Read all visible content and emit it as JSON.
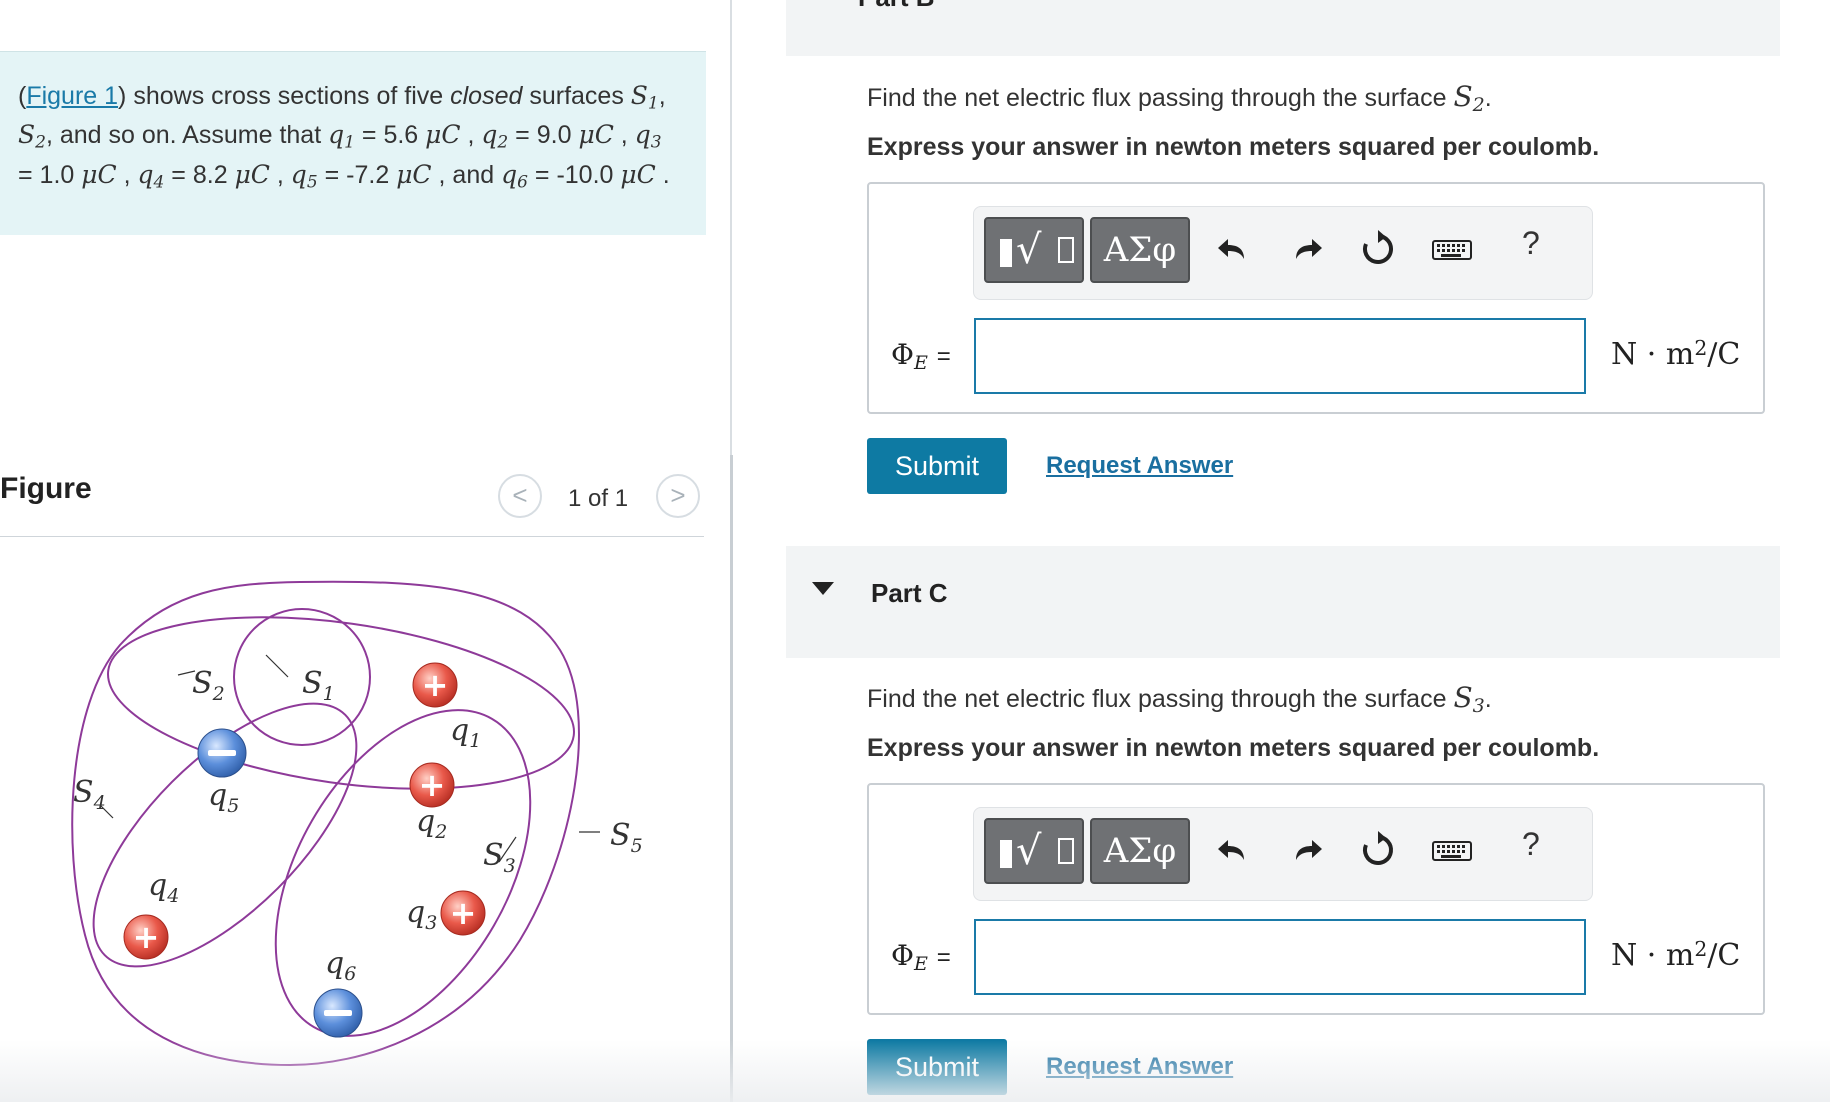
{
  "problem": {
    "figure_link": "Figure 1",
    "text_intro": "shows cross sections of five",
    "text_closed": "closed",
    "text_surfaces": "surfaces",
    "assume": ", and so on. Assume that",
    "q1_value": "5.6",
    "q2_value": "9.0",
    "q3_value": "1.0",
    "q4_value": "8.2",
    "q5_value": "-7.2",
    "q6_value": "-10.0",
    "unit": "μC",
    "and": "and"
  },
  "figure": {
    "heading": "Figure",
    "pager_label": "1 of 1",
    "prev": "<",
    "next": ">",
    "labels": {
      "S1": "S",
      "S1_sub": "1",
      "S2": "S",
      "S2_sub": "2",
      "S3": "S",
      "S3_sub": "3",
      "S4": "S",
      "S4_sub": "4",
      "S5": "S",
      "S5_sub": "5",
      "q1": "q",
      "q1_sub": "1",
      "q2": "q",
      "q2_sub": "2",
      "q3": "q",
      "q3_sub": "3",
      "q4": "q",
      "q4_sub": "4",
      "q5": "q",
      "q5_sub": "5",
      "q6": "q",
      "q6_sub": "6"
    },
    "colors": {
      "surface": "#8e3a99",
      "positive": "#e24b3b",
      "negative": "#4a7fcf"
    }
  },
  "partB": {
    "title": "Part B",
    "question": "Find the net electric flux passing through the surface",
    "surface": "S",
    "surface_sub": "2",
    "instruction": "Express your answer in newton meters squared per coulomb.",
    "phi_label": "Φ",
    "phi_sub": "E",
    "equals": "=",
    "input_value": "",
    "unit_main": "N · m",
    "unit_sup": "2",
    "unit_tail": "/C",
    "submit": "Submit",
    "request": "Request Answer"
  },
  "partC": {
    "title": "Part C",
    "question": "Find the net electric flux passing through the surface",
    "surface": "S",
    "surface_sub": "3",
    "instruction": "Express your answer in newton meters squared per coulomb.",
    "phi_label": "Φ",
    "phi_sub": "E",
    "equals": "=",
    "input_value": "",
    "unit_main": "N · m",
    "unit_sup": "2",
    "unit_tail": "/C",
    "submit": "Submit",
    "request": "Request Answer"
  },
  "toolbar": {
    "greek": "ΑΣφ",
    "help": "?",
    "icons": [
      "templates-icon",
      "greek-symbols-icon",
      "undo-icon",
      "redo-icon",
      "reset-icon",
      "keyboard-icon",
      "help-icon"
    ]
  }
}
